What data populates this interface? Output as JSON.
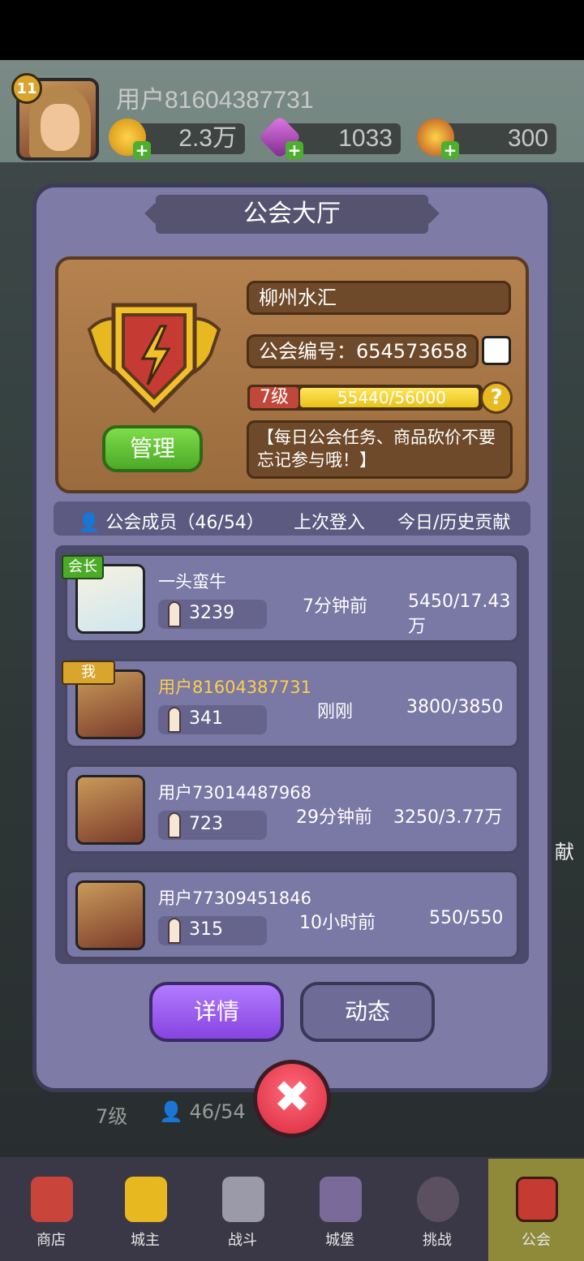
{
  "hud": {
    "level": "11",
    "username": "用户81604387731",
    "gold": "2.3万",
    "gems": "1033",
    "stamina": "300"
  },
  "dialog": {
    "title": "公会大厅",
    "guild_name": "柳州水汇",
    "guild_id": "公会编号：654573658",
    "level_label": "7级",
    "exp_text": "55440/56000",
    "exp_progress": 0.99,
    "manage_label": "管理",
    "notice": "【每日公会任务、商品砍价不要忘记参与哦！】",
    "help_label": "?",
    "header": {
      "members": "公会成员（46/54）",
      "last_login": "上次登入",
      "contribution": "今日/历史贡献"
    },
    "members": [
      {
        "tag": "会长",
        "name": "一头蛮牛",
        "power": "3239",
        "last_login": "7分钟前",
        "contribution": "5450/17.43万"
      },
      {
        "tag": "我",
        "name": "用户81604387731",
        "power": "341",
        "last_login": "刚刚",
        "contribution": "3800/3850"
      },
      {
        "tag": "",
        "name": "用户73014487968",
        "power": "723",
        "last_login": "29分钟前",
        "contribution": "3250/3.77万"
      },
      {
        "tag": "",
        "name": "用户77309451846",
        "power": "315",
        "last_login": "10小时前",
        "contribution": "550/550"
      }
    ],
    "detail_label": "详情",
    "feed_label": "动态",
    "close_label": "✖"
  },
  "under": {
    "level": "7级",
    "members": "46/54",
    "side_text": "献"
  },
  "nav": [
    {
      "label": "商店"
    },
    {
      "label": "城主"
    },
    {
      "label": "战斗"
    },
    {
      "label": "城堡"
    },
    {
      "label": "挑战"
    },
    {
      "label": "公会"
    }
  ],
  "colors": {
    "dialog_bg": "#7e7ba6",
    "accent_purple": "#8744e0",
    "close_red": "#d8283c",
    "gold_tag": "#d9a52d",
    "green_tag": "#4caa28"
  }
}
